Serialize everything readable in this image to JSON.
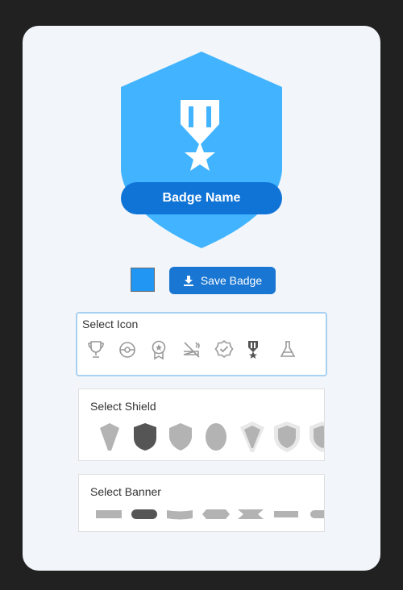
{
  "badge": {
    "name": "Badge Name",
    "shield_color": "#42b4ff",
    "banner_color": "#0f74d6",
    "selected_icon": "medal-icon"
  },
  "controls": {
    "color_value": "#2196f3",
    "save_label": "Save Badge"
  },
  "icon_panel": {
    "title": "Select Icon",
    "icons": [
      "trophy-icon",
      "pokeball-icon",
      "award-ribbon-icon",
      "no-smoking-icon",
      "verified-badge-icon",
      "medal-icon",
      "flask-icon"
    ],
    "selected": "medal-icon"
  },
  "shield_panel": {
    "title": "Select Shield",
    "shapes": [
      "diamond-shield",
      "rounded-shield",
      "heater-shield",
      "oval-shield",
      "framed-diamond-shield",
      "framed-heater-shield",
      "framed-partial-shield"
    ],
    "selected": "rounded-shield"
  },
  "banner_panel": {
    "title": "Select Banner",
    "shapes": [
      "flat-banner",
      "pill-banner",
      "curved-banner",
      "hexagon-banner",
      "ribbon-banner",
      "plain-banner",
      "round-banner"
    ],
    "selected": "pill-banner"
  }
}
